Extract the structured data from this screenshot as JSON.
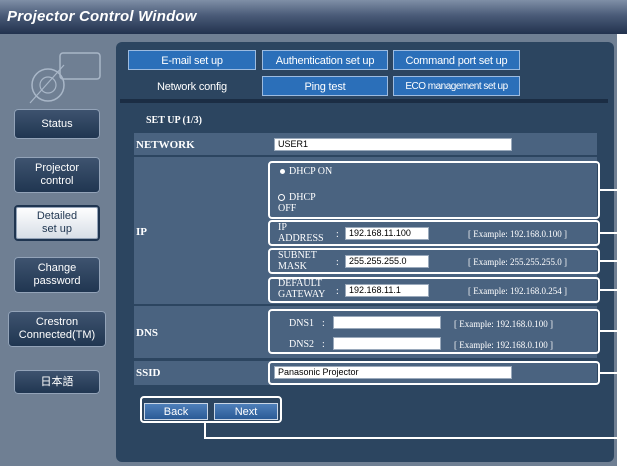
{
  "window": {
    "title": "Projector Control Window"
  },
  "sidebar": {
    "items": [
      {
        "label": "Status"
      },
      {
        "label": "Projector control"
      },
      {
        "label": "Detailed set up"
      },
      {
        "label": "Change password"
      },
      {
        "label": "Crestron Connected(TM)"
      },
      {
        "label": "日本語"
      }
    ]
  },
  "tabs": {
    "row1": [
      {
        "label": "E-mail set up"
      },
      {
        "label": "Authentication set up"
      },
      {
        "label": "Command port set up"
      }
    ],
    "row2": [
      {
        "label": "Network config"
      },
      {
        "label": "Ping test"
      },
      {
        "label": "ECO management set up"
      }
    ]
  },
  "form": {
    "heading": "SET UP (1/3)",
    "network": {
      "label": "NETWORK",
      "value": "USER1"
    },
    "ip": {
      "label": "IP",
      "dhcp_on": "DHCP ON",
      "dhcp_off": "DHCP OFF",
      "ip_address": {
        "label": "IP ADDRESS",
        "value": "192.168.11.100",
        "example": "[ Example: 192.168.0.100 ]"
      },
      "subnet_mask": {
        "label": "SUBNET MASK",
        "value": "255.255.255.0",
        "example": "[ Example: 255.255.255.0 ]"
      },
      "default_gateway": {
        "label": "DEFAULT GATEWAY",
        "value": "192.168.11.1",
        "example": "[ Example: 192.168.0.254 ]"
      }
    },
    "dns": {
      "label": "DNS",
      "dns1": {
        "label": "DNS1",
        "value": "",
        "example": "[ Example: 192.168.0.100 ]"
      },
      "dns2": {
        "label": "DNS2",
        "value": "",
        "example": "[ Example: 192.168.0.100 ]"
      }
    },
    "ssid": {
      "label": "SSID",
      "value": "Panasonic Projector"
    }
  },
  "buttons": {
    "back": "Back",
    "next": "Next"
  },
  "colors": {
    "titlebar": "#22324e",
    "panel": "#2c4560",
    "tab": "#2b6fb9"
  }
}
